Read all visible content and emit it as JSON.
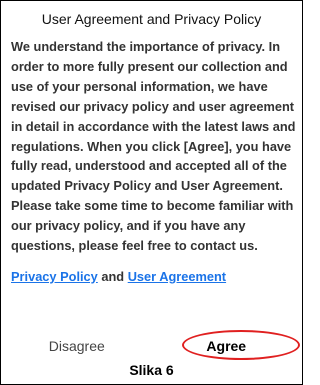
{
  "dialog": {
    "title": "User Agreement and Privacy Policy",
    "body": "We understand the importance of privacy. In order to more fully present our collection and use of your personal information, we have revised our privacy policy and user agreement in detail in accordance with the latest laws and regulations. When you click [Agree], you have fully read, understood and accepted all of the updated Privacy Policy and User Agreement. Please take some time to become familiar with our privacy policy, and if you have any questions, please feel free to contact us.",
    "links": {
      "privacy_policy": "Privacy Policy",
      "connector": "and",
      "user_agreement": "User Agreement"
    },
    "buttons": {
      "disagree": "Disagree",
      "agree": "Agree"
    }
  },
  "caption": "Slika 6",
  "colors": {
    "link": "#1a73e8",
    "highlight": "#e02020"
  }
}
